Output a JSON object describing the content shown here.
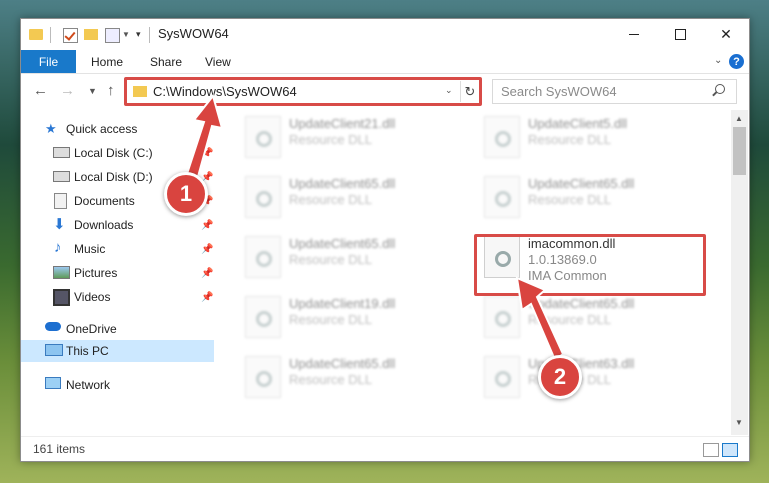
{
  "window": {
    "title": "SysWOW64",
    "minimize_label": "",
    "maximize_label": "",
    "close_label": "✕"
  },
  "ribbon": {
    "tabs": [
      "File",
      "Home",
      "Share",
      "View"
    ],
    "help": "?"
  },
  "navigation": {
    "address": "C:\\Windows\\SysWOW64",
    "search_placeholder": "Search SysWOW64"
  },
  "sidebar": {
    "items": [
      {
        "label": "Quick access",
        "icon": "star-icon",
        "pinned": false
      },
      {
        "label": "Local Disk (C:)",
        "icon": "drive-icon",
        "pinned": true
      },
      {
        "label": "Local Disk (D:)",
        "icon": "drive-icon",
        "pinned": true
      },
      {
        "label": "Documents",
        "icon": "documents-icon",
        "pinned": true
      },
      {
        "label": "Downloads",
        "icon": "download-icon",
        "pinned": true
      },
      {
        "label": "Music",
        "icon": "music-icon",
        "pinned": true
      },
      {
        "label": "Pictures",
        "icon": "pictures-icon",
        "pinned": true
      },
      {
        "label": "Videos",
        "icon": "videos-icon",
        "pinned": true
      },
      {
        "label": "OneDrive",
        "icon": "cloud-icon",
        "pinned": false
      },
      {
        "label": "This PC",
        "icon": "computer-icon",
        "pinned": false,
        "selected": true
      },
      {
        "label": "Network",
        "icon": "network-icon",
        "pinned": false
      }
    ]
  },
  "files": [
    {
      "name": "UpdateClient21.dll",
      "type": "Resource DLL",
      "extra": ""
    },
    {
      "name": "UpdateClient5.dll",
      "type": "Resource DLL",
      "extra": ""
    },
    {
      "name": "UpdateClient65.dll",
      "type": "Resource DLL",
      "extra": ""
    },
    {
      "name": "UpdateClient65.dll",
      "type": "Resource DLL",
      "extra": ""
    },
    {
      "name": "UpdateClient65.dll",
      "type": "Resource DLL",
      "extra": ""
    },
    {
      "name": "imacommon.dll",
      "type": "1.0.13869.0",
      "extra": "IMA Common",
      "highlighted": true
    },
    {
      "name": "UpdateClient19.dll",
      "type": "Resource DLL",
      "extra": ""
    },
    {
      "name": "UpdateClient65.dll",
      "type": "Resource DLL",
      "extra": ""
    },
    {
      "name": "UpdateClient65.dll",
      "type": "Resource DLL",
      "extra": ""
    },
    {
      "name": "UpdateClient63.dll",
      "type": "Resource DLL",
      "extra": ""
    }
  ],
  "status": {
    "item_count": "161 items"
  },
  "annotations": {
    "badge1": "1",
    "badge2": "2",
    "color": "#d9443f"
  }
}
